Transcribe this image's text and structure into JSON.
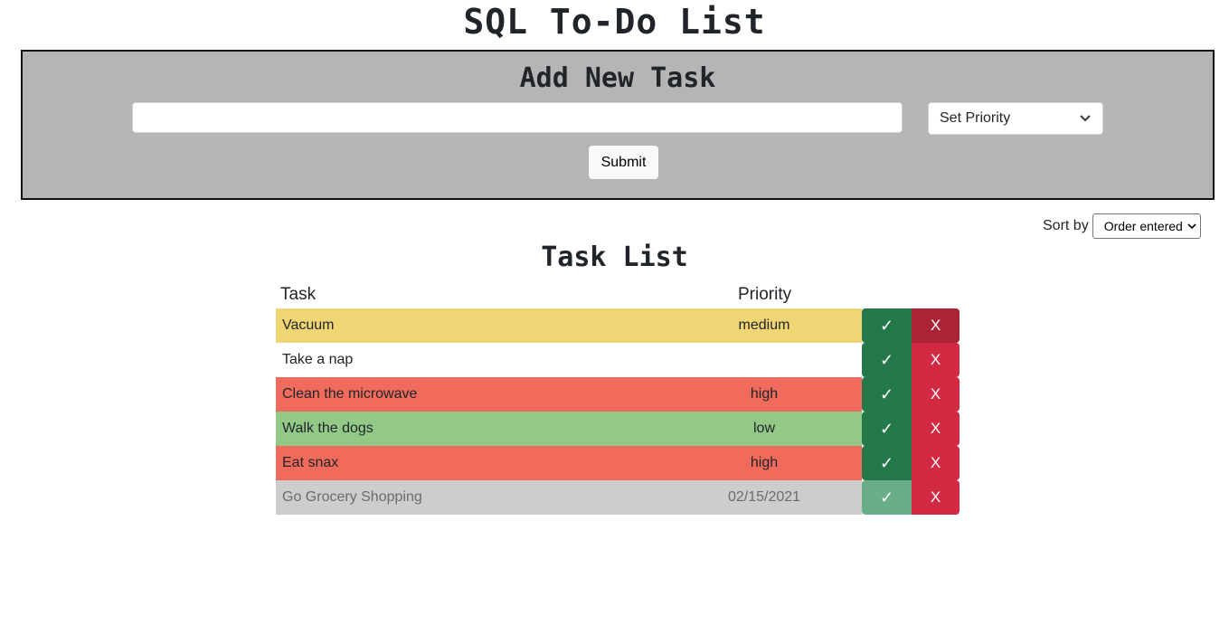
{
  "page": {
    "title": "SQL To-Do List"
  },
  "add_task": {
    "heading": "Add New Task",
    "input_value": "",
    "input_placeholder": "",
    "priority_selected": "Set Priority",
    "submit_label": "Submit"
  },
  "sort": {
    "label": "Sort by",
    "selected": "Order entered"
  },
  "task_list": {
    "heading": "Task List",
    "columns": [
      "Task",
      "Priority"
    ],
    "done_symbol": "✓",
    "delete_symbol": "X",
    "rows": [
      {
        "task": "Vacuum",
        "priority": "medium",
        "color": "#f0d574",
        "completed": false
      },
      {
        "task": "Take a nap",
        "priority": "",
        "color": "#ffffff",
        "completed": false
      },
      {
        "task": "Clean the microwave",
        "priority": "high",
        "color": "#f06b5b",
        "completed": false
      },
      {
        "task": "Walk the dogs",
        "priority": "low",
        "color": "#93c986",
        "completed": false
      },
      {
        "task": "Eat snax",
        "priority": "high",
        "color": "#f06b5b",
        "completed": false
      },
      {
        "task": "Go Grocery Shopping",
        "priority": "02/15/2021",
        "color": "#cdcdcd",
        "completed": true
      }
    ]
  },
  "colors": {
    "panel_bg": "#b5b5b5",
    "done_button": "#25784a",
    "done_button_completed": "#6aae89",
    "delete_button": "#d12a42",
    "delete_button_hover": "#ab2436"
  }
}
